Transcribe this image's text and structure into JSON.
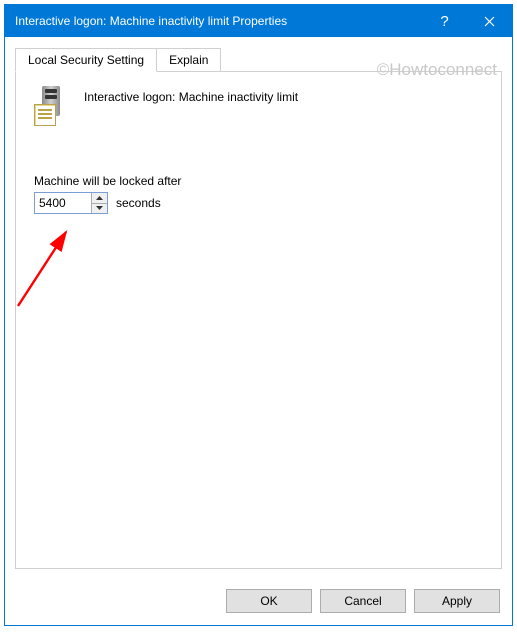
{
  "titlebar": {
    "title": "Interactive logon: Machine inactivity limit Properties"
  },
  "tabs": {
    "local": "Local Security Setting",
    "explain": "Explain"
  },
  "policy": {
    "title": "Interactive logon: Machine inactivity limit",
    "lock_label": "Machine will be locked after",
    "value": "5400",
    "unit": "seconds"
  },
  "buttons": {
    "ok": "OK",
    "cancel": "Cancel",
    "apply": "Apply"
  },
  "watermark": "©Howtoconnect"
}
